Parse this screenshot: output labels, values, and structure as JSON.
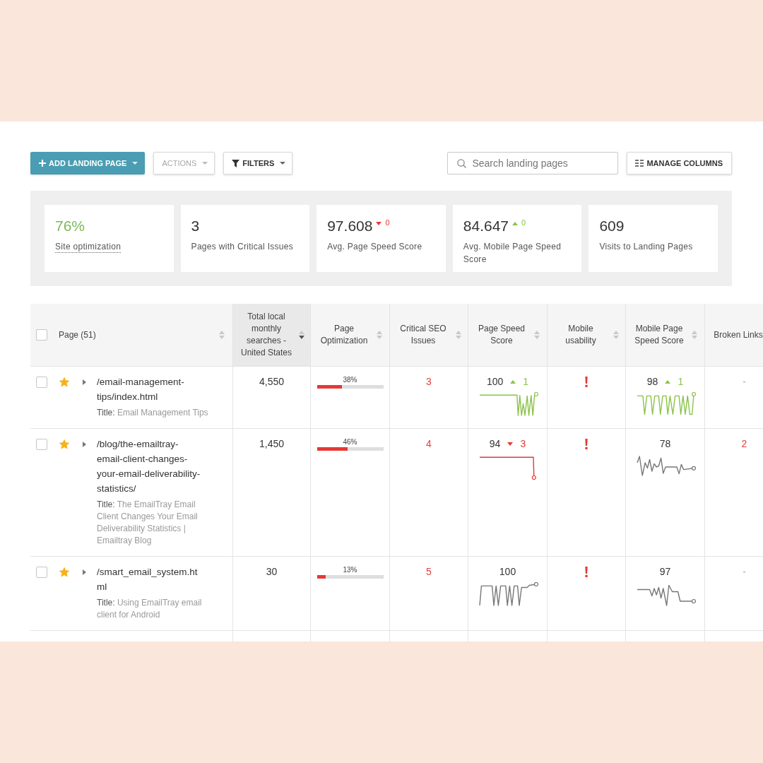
{
  "toolbar": {
    "buttons": [
      {
        "kind": "create",
        "label": "ADD LANDING PAGE",
        "dropdown": true,
        "disabled": false
      },
      {
        "kind": "menu",
        "label": "ACTIONS",
        "dropdown": true,
        "disabled": true
      },
      {
        "kind": "filter",
        "label": "FILTERS",
        "dropdown": true,
        "disabled": false
      }
    ],
    "search": {
      "placeholder": "Search landing pages"
    },
    "columns_button": {
      "label": "MANAGE COLUMNS"
    }
  },
  "stats": {
    "cards": [
      {
        "value": "76%",
        "label": "Site optimization",
        "color": "#7cb85a",
        "tooltip": true
      },
      {
        "value": "3",
        "label": "Pages with Critical Issues",
        "color": "#333333",
        "tooltip": false
      },
      {
        "value": "97.608",
        "label": "Avg. Page Speed Score",
        "color": "#333333",
        "tooltip": false,
        "change": {
          "increase": false,
          "value": "0"
        }
      },
      {
        "value": "84.647",
        "label": "Avg. Mobile Page Speed Score",
        "color": "#333333",
        "tooltip": false,
        "change": {
          "increase": true,
          "value": "0"
        }
      },
      {
        "value": "609",
        "label": "Visits to Landing Pages",
        "color": "#333333",
        "tooltip": false
      }
    ]
  },
  "table": {
    "select_all": {
      "checked": false
    },
    "columns": [
      {
        "label": "Page (51)",
        "sorted": false
      },
      {
        "label": "Total local monthly searches - United States",
        "sorted": true
      },
      {
        "label": "Page Optimization",
        "sorted": false
      },
      {
        "label": "Critical SEO Issues",
        "sorted": false
      },
      {
        "label": "Page Speed Score",
        "sorted": false
      },
      {
        "label": "Mobile usability",
        "sorted": false
      },
      {
        "label": "Mobile Page Speed Score",
        "sorted": false
      },
      {
        "label": "Broken Links"
      }
    ],
    "rows": [
      {
        "checked": false,
        "starred": true,
        "expanded": false,
        "path": "/email-management-tips/index.html",
        "title_label": "Title:",
        "title": "Email Management Tips",
        "searches": "4,550",
        "optimization": {
          "level": 0.38,
          "reading": "38%"
        },
        "critical_issues": "3",
        "page_speed": {
          "score": "100",
          "change": {
            "increase": true,
            "value": "1"
          }
        },
        "mobile_issue": true,
        "mobile_page_speed": {
          "score": "98",
          "change": {
            "increase": true,
            "value": "1"
          }
        },
        "broken_links": {
          "value": "-",
          "alert": false
        }
      },
      {
        "checked": false,
        "starred": true,
        "expanded": false,
        "path": "/blog/the-emailtray-email-client-changes-your-email-deliverability-statistics/",
        "title_label": "Title:",
        "title": "The EmailTray Email Client Changes Your Email Deliverability Statistics | Emailtray Blog",
        "searches": "1,450",
        "optimization": {
          "level": 0.46,
          "reading": "46%"
        },
        "critical_issues": "4",
        "page_speed": {
          "score": "94",
          "change": {
            "increase": false,
            "value": "3"
          }
        },
        "mobile_issue": true,
        "mobile_page_speed": {
          "score": "78"
        },
        "broken_links": {
          "value": "2",
          "alert": true
        }
      },
      {
        "checked": false,
        "starred": true,
        "expanded": false,
        "path": "/smart_email_system.html",
        "title_label": "Title:",
        "title": "Using EmailTray email client for Android",
        "searches": "30",
        "optimization": {
          "level": 0.13,
          "reading": "13%"
        },
        "critical_issues": "5",
        "page_speed": {
          "score": "100"
        },
        "mobile_issue": true,
        "mobile_page_speed": {
          "score": "97"
        },
        "broken_links": {
          "value": "-",
          "alert": false
        }
      }
    ]
  }
}
